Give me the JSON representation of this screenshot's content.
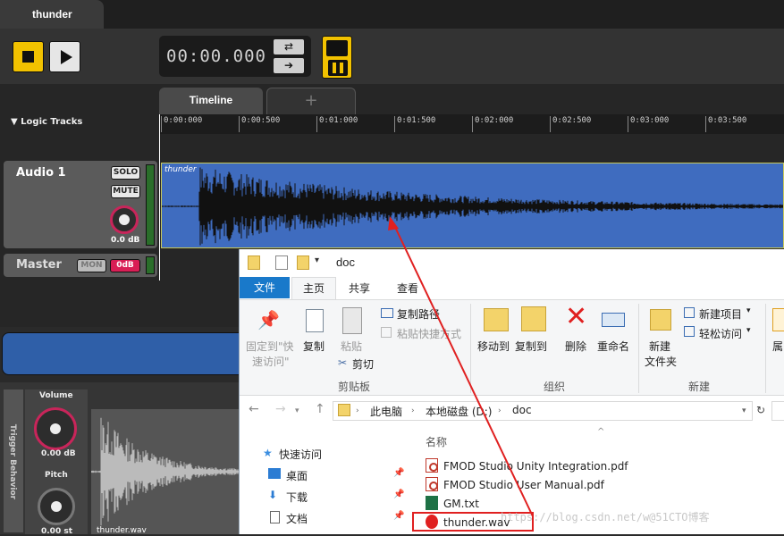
{
  "fmod": {
    "window_tab": "thunder",
    "time_display": "00:00.000",
    "tabs": [
      "Timeline",
      "+"
    ],
    "logic_tracks": "▼  Logic Tracks",
    "ruler_ticks": [
      "0:00:000",
      "0:00:500",
      "0:01:000",
      "0:01:500",
      "0:02:000",
      "0:02:500",
      "0:03:000",
      "0:03:500"
    ],
    "audio_track": {
      "name": "Audio 1",
      "solo": "SOLO",
      "mute": "MUTE",
      "volume": "0.0 dB"
    },
    "clip_name": "thunder",
    "master": {
      "name": "Master",
      "mon": "MON",
      "vol": "0dB"
    },
    "trigger_label": "Trigger Behavior",
    "deck": {
      "volume_label": "Volume",
      "volume_value": "0.00 dB",
      "pitch_label": "Pitch",
      "pitch_value": "0.00 st",
      "clip": "thunder.wav"
    },
    "accent": "#f2c200",
    "wave_color": "#3f6cbf"
  },
  "explorer": {
    "title": "doc",
    "ribbon_tabs": {
      "file": "文件",
      "home": "主页",
      "share": "共享",
      "view": "查看"
    },
    "clipboard": {
      "pin": "固定到\"快",
      "pin2": "速访问\"",
      "copy": "复制",
      "paste": "粘贴",
      "copy_path": "复制路径",
      "paste_shortcut": "粘贴快捷方式",
      "cut": "剪切",
      "group": "剪贴板"
    },
    "organize": {
      "move_to": "移动到",
      "copy_to": "复制到",
      "delete": "删除",
      "rename": "重命名",
      "group": "组织"
    },
    "new": {
      "new_folder": "新建",
      "new_folder2": "文件夹",
      "new_item": "新建项目",
      "easy_access": "轻松访问",
      "group": "新建"
    },
    "more": "属",
    "breadcrumb": [
      "此电脑",
      "本地磁盘 (D:)",
      "doc"
    ],
    "nav": [
      {
        "label": "快速访问",
        "icon": "star-icon"
      },
      {
        "label": "桌面",
        "icon": "desktop-icon"
      },
      {
        "label": "下载",
        "icon": "download-icon"
      },
      {
        "label": "文档",
        "icon": "document-icon"
      }
    ],
    "column": "名称",
    "files": [
      {
        "name": "FMOD Studio Unity Integration.pdf",
        "type": "pdf"
      },
      {
        "name": "FMOD Studio User Manual.pdf",
        "type": "pdf"
      },
      {
        "name": "GM.txt",
        "type": "xls"
      },
      {
        "name": "thunder.wav",
        "type": "wav"
      }
    ]
  },
  "watermark": "https://blog.csdn.net/w@51CTO博客"
}
